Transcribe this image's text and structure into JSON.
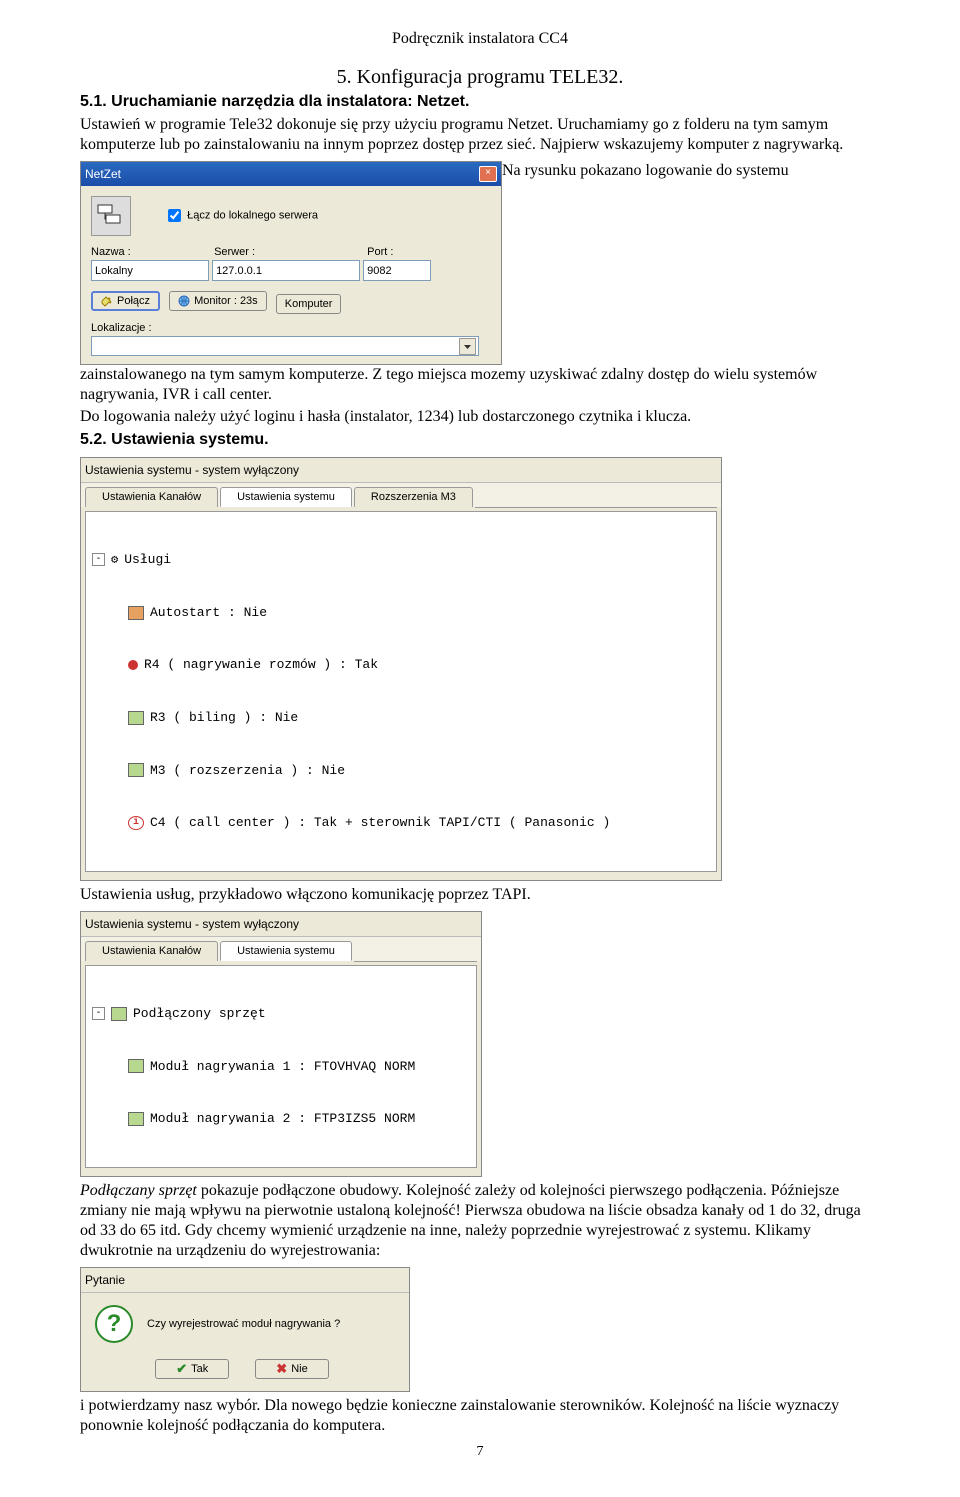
{
  "doc": {
    "running_head": "Podręcznik instalatora CC4",
    "chapter_title": "5. Konfiguracja programu TELE32.",
    "sec51_head": "5.1. Uruchamianie narzędzia dla instalatora: Netzet.",
    "p1": "Ustawień w programie Tele32 dokonuje się przy użyciu programu Netzet. Uruchamiamy go z folderu na tym samym komputerze lub po zainstalowaniu na innym poprzez dostęp przez sieć. Najpierw wskazujemy komputer z nagrywarką.",
    "after_netzet": "Na rysunku pokazano logowanie do systemu zainstalowanego na tym samym komputerze. Z tego miejsca mozemy uzyskiwać zdalny dostęp do wielu systemów nagrywania, IVR i call center.",
    "p_login": "Do logowania należy użyć loginu i hasła (instalator, 1234) lub dostarczonego czytnika i klucza.",
    "sec52_head": "5.2. Ustawienia systemu.",
    "p_tapi": "Ustawienia usług, przykładowo włączono komunikację poprzez TAPI.",
    "p_sprzet_prefix_em": "Podłączany sprzęt",
    "p_sprzet_rest": " pokazuje podłączone obudowy. Kolejność zależy od kolejności pierwszego podłączenia. Późniejsze zmiany nie mają wpływu na pierwotnie ustaloną kolejność! Pierwsza obudowa na liście obsadza kanały od 1 do 32, druga od 33 do 65 itd. Gdy chcemy wymienić urządzenie na inne, należy poprzednie wyrejestrować z systemu. Klikamy dwukrotnie na urządzeniu do wyrejestrowania:",
    "p_last": "i potwierdzamy nasz wybór. Dla nowego będzie konieczne zainstalowanie sterowników. Kolejność na liście wyznaczy ponownie kolejność podłączania do komputera.",
    "page_number": "7"
  },
  "netzet": {
    "title": "NetZet",
    "checkbox_label": "Łącz do lokalnego serwera",
    "label_name": "Nazwa :",
    "label_server": "Serwer :",
    "label_port": "Port :",
    "value_name": "Lokalny",
    "value_server": "127.0.0.1",
    "value_port": "9082",
    "btn_connect": "Połącz",
    "btn_monitor": "Monitor : 23s",
    "btn_komputer": "Komputer",
    "label_lokal": "Lokalizacje :"
  },
  "sys1": {
    "title": "Ustawienia systemu - system wyłączony",
    "tab1": "Ustawienia Kanałów",
    "tab2": "Ustawienia systemu",
    "tab3": "Rozszerzenia M3",
    "node_uslugi": "Usługi",
    "row_autostart": "Autostart                : Nie",
    "row_r4": "R4 ( nagrywanie rozmów ) : Tak",
    "row_r3": "R3 ( biling )            : Nie",
    "row_m3": "M3 ( rozszerzenia )      : Nie",
    "row_c4": "C4 ( call center )       : Tak + sterownik TAPI/CTI ( Panasonic )"
  },
  "sys2": {
    "title": "Ustawienia systemu - system wyłączony",
    "tab1": "Ustawienia Kanałów",
    "tab2": "Ustawienia systemu",
    "node_sprzet": "Podłączony sprzęt",
    "row_m1": "Moduł nagrywania 1 : FTOVHVAQ NORM",
    "row_m2": "Moduł nagrywania 2 : FTP3IZS5 NORM"
  },
  "pytanie": {
    "title": "Pytanie",
    "msg": "Czy wyrejestrować moduł nagrywania ?",
    "yes": "Tak",
    "no": "Nie"
  }
}
